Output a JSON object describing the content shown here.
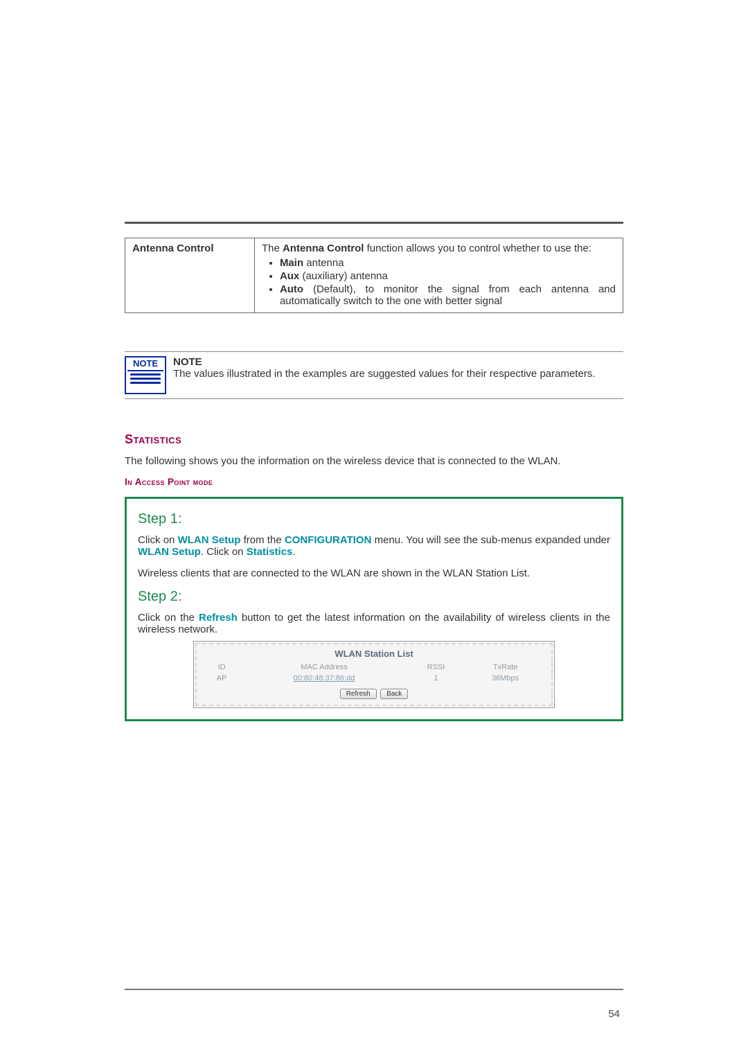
{
  "config_row": {
    "label": "Antenna Control",
    "intro_pre": "The ",
    "intro_bold": "Antenna Control",
    "intro_post": " function allows you to control whether to use the:",
    "bullets": [
      {
        "bold": "Main",
        "rest": " antenna"
      },
      {
        "bold": "Aux",
        "rest": " (auxiliary) antenna"
      },
      {
        "bold": "Auto",
        "rest": " (Default), to monitor the signal from each antenna and automatically switch to the one with better signal"
      }
    ]
  },
  "note": {
    "icon_word": "NOTE",
    "heading": "NOTE",
    "body": "The values illustrated in the examples are suggested values for their respective parameters."
  },
  "stats_section": {
    "heading": "Statistics",
    "intro": "The following shows you the information on the wireless device that is connected to the WLAN.",
    "mode_heading": "In Access Point mode"
  },
  "steps": {
    "step1_title": "Step 1:",
    "step1_p1_a": "Click on ",
    "step1_p1_link1": "WLAN Setup",
    "step1_p1_b": " from the ",
    "step1_p1_link2": "CONFIGURATION",
    "step1_p1_c": " menu. You will see the sub-menus expanded under ",
    "step1_p1_link3": "WLAN Setup",
    "step1_p1_d": ". Click on ",
    "step1_p1_link4": "Statistics",
    "step1_p1_e": ".",
    "step1_p2": "Wireless clients that are connected to the WLAN are shown in the WLAN Station List.",
    "step2_title": "Step 2:",
    "step2_p1_a": "Click on the ",
    "step2_p1_link": "Refresh",
    "step2_p1_b": " button to get the latest information on the availability of wireless clients in the wireless network."
  },
  "screenshot": {
    "title": "WLAN Station List",
    "headers": [
      "ID",
      "MAC Address",
      "RSSI",
      "TxRate"
    ],
    "row": {
      "id": "AP",
      "mac": "00:80:48:37:86:dd",
      "rssi": "1",
      "txrate": "36Mbps"
    },
    "btn_refresh": "Refresh",
    "btn_back": "Back"
  },
  "page_number": "54"
}
